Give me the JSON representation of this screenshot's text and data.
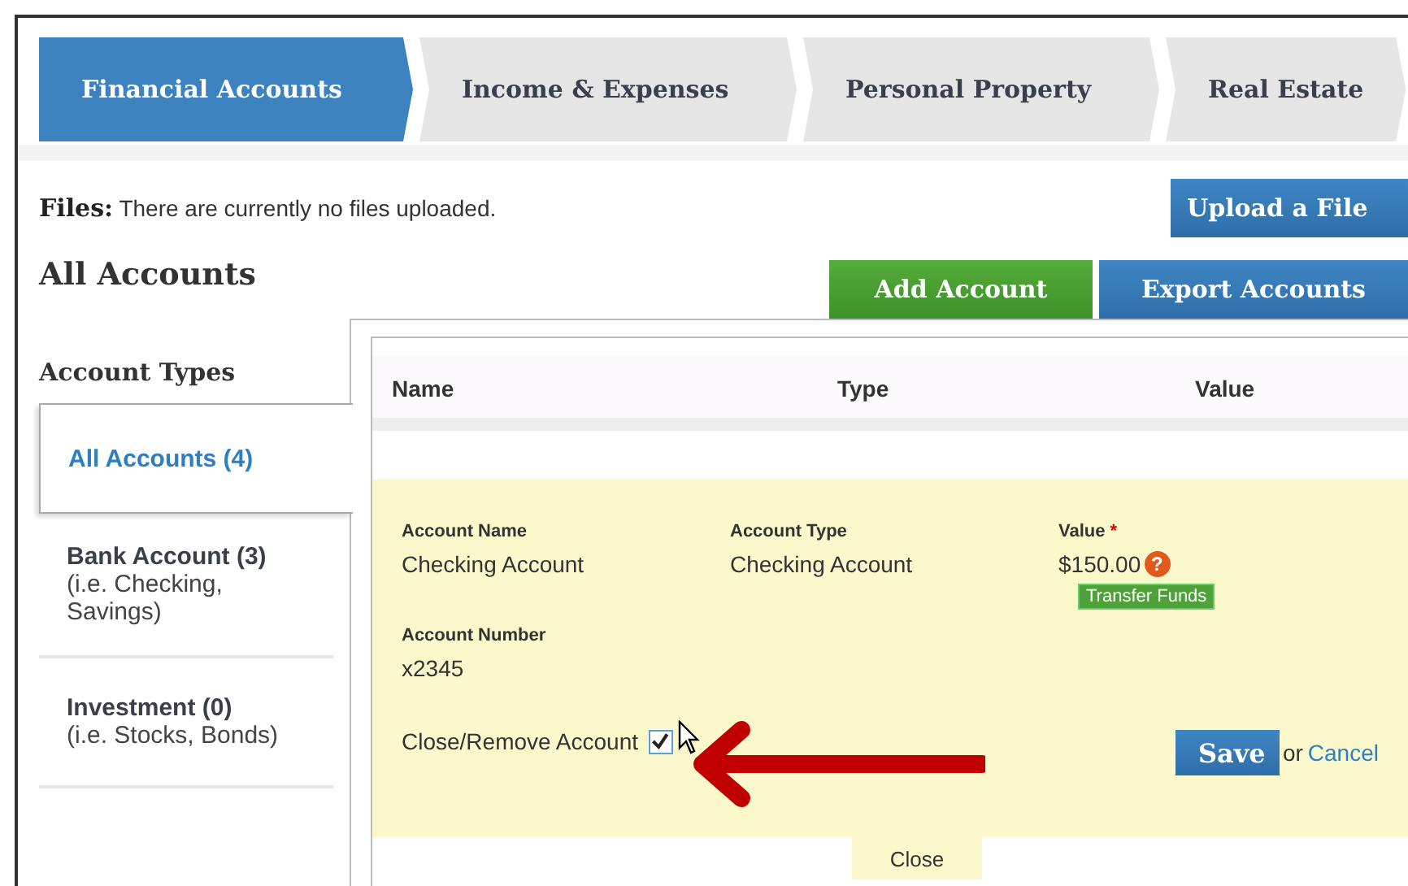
{
  "tabs": [
    {
      "label": "Financial Accounts",
      "selected": true
    },
    {
      "label": "Income & Expenses",
      "selected": false
    },
    {
      "label": "Personal Property",
      "selected": false
    },
    {
      "label": "Real Estate",
      "selected": false
    }
  ],
  "files": {
    "label": "Files:",
    "text": "There are currently no files uploaded.",
    "upload_button": "Upload a File"
  },
  "heading": "All Accounts",
  "actions": [
    {
      "label": "Add Account",
      "kind": "add"
    },
    {
      "label": "Export Accounts",
      "kind": "export"
    }
  ],
  "sidebar": {
    "title": "Account Types",
    "items": [
      {
        "label": "All Accounts (4)",
        "selected": true
      },
      {
        "label": "Bank Account (3)",
        "hint": "(i.e. Checking, Savings)",
        "selected": false
      },
      {
        "label": "Investment (0)",
        "hint": "(i.e. Stocks, Bonds)",
        "selected": false
      }
    ]
  },
  "table": {
    "columns": [
      "Name",
      "Type",
      "Value"
    ]
  },
  "editor": {
    "fields": [
      {
        "label": "Account Name",
        "value": "Checking Account"
      },
      {
        "label": "Account Type",
        "value": "Checking Account"
      },
      {
        "label": "Value",
        "value": "$150.00",
        "required_mark": "*",
        "help_icon": "?",
        "button": "Transfer Funds"
      }
    ],
    "number": {
      "label": "Account Number",
      "value": "x2345"
    },
    "close_checkbox": {
      "label": "Close/Remove Account",
      "checked": true
    },
    "save": "Save",
    "or": "or",
    "cancel": "Cancel",
    "close": "Close"
  }
}
